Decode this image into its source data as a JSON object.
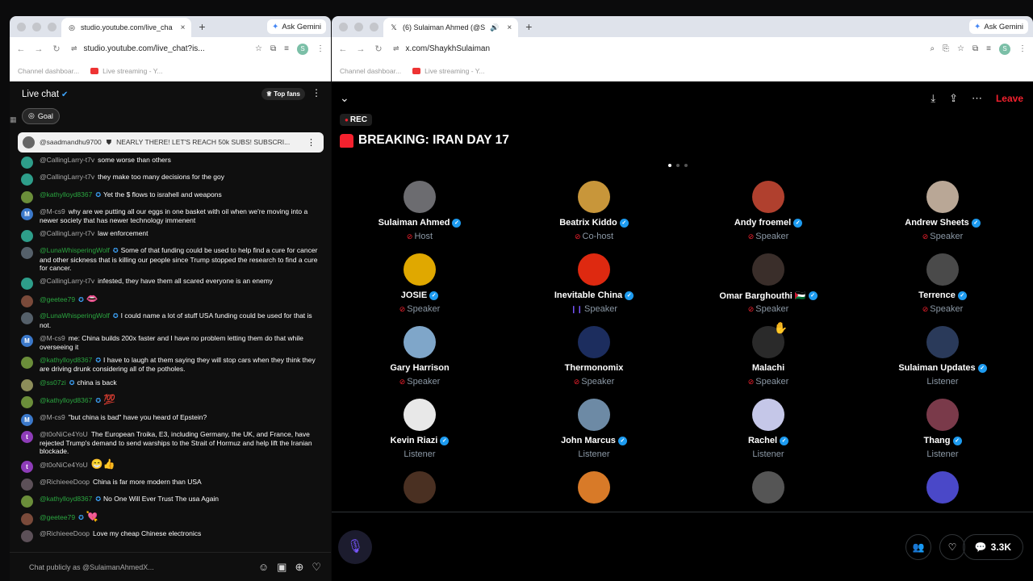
{
  "left_window": {
    "tab": {
      "title": "studio.youtube.com/live_cha",
      "close": "×"
    },
    "new_tab": "+",
    "gemini": "Ask Gemini",
    "url": "studio.youtube.com/live_chat?is...",
    "bookmarks": [
      "Channel dashboar...",
      "Live streaming - Y..."
    ],
    "profile_initial": "S"
  },
  "chat": {
    "title": "Live chat",
    "top_fans": "Top fans",
    "goal": "Goal",
    "pinned": {
      "author": "@saadmandhu9700",
      "text": "NEARLY THERE! LET'S REACH 50k SUBS! SUBSCRI..."
    },
    "messages": [
      {
        "author": "@CallingLarry-t7v",
        "text": "some worse than others",
        "member": false,
        "badge": false,
        "avatar_color": "#2e9e8a",
        "avatar_text": ""
      },
      {
        "author": "@CallingLarry-t7v",
        "text": "they make too many decisions for the goy",
        "member": false,
        "badge": false,
        "avatar_color": "#2e9e8a",
        "avatar_text": ""
      },
      {
        "author": "@kathylloyd8367",
        "text": "Yet the $ flows to israhell and weapons",
        "member": true,
        "badge": true,
        "avatar_color": "#6b8e3a",
        "avatar_text": ""
      },
      {
        "author": "@M-cs9",
        "text": "why are we putting all our eggs in one basket with oil when we're moving into a newer society that has newer technology immenent",
        "member": false,
        "badge": false,
        "avatar_color": "#3b78c9",
        "avatar_text": "M"
      },
      {
        "author": "@CallingLarry-t7v",
        "text": "law enforcement",
        "member": false,
        "badge": false,
        "avatar_color": "#2e9e8a",
        "avatar_text": ""
      },
      {
        "author": "@LunaWhisperingWolf",
        "text": "Some of that funding could be used to help find a cure for cancer and other sickness that is killing our people since Trump stopped the research to find a cure for cancer.",
        "member": true,
        "badge": true,
        "avatar_color": "#55606a",
        "avatar_text": ""
      },
      {
        "author": "@CallingLarry-t7v",
        "text": "infested, they have them all scared everyone is an enemy",
        "member": false,
        "badge": false,
        "avatar_color": "#2e9e8a",
        "avatar_text": ""
      },
      {
        "author": "@geetee79",
        "text": "👄",
        "member": true,
        "badge": true,
        "avatar_color": "#7a4a3a",
        "avatar_text": ""
      },
      {
        "author": "@LunaWhisperingWolf",
        "text": "I could name a lot of stuff USA funding could be used for that is not.",
        "member": true,
        "badge": true,
        "avatar_color": "#55606a",
        "avatar_text": ""
      },
      {
        "author": "@M-cs9",
        "text": "me: China builds 200x faster and I have no problem letting them do that while overseeing it",
        "member": false,
        "badge": false,
        "avatar_color": "#3b78c9",
        "avatar_text": "M"
      },
      {
        "author": "@kathylloyd8367",
        "text": "I have to laugh at them saying they will stop cars when they think they are driving drunk considering all of the potholes.",
        "member": true,
        "badge": true,
        "avatar_color": "#6b8e3a",
        "avatar_text": ""
      },
      {
        "author": "@ss07zi",
        "text": "china is back",
        "member": true,
        "badge": true,
        "avatar_color": "#8d8d5a",
        "avatar_text": ""
      },
      {
        "author": "@kathylloyd8367",
        "text": "💯",
        "member": true,
        "badge": true,
        "avatar_color": "#6b8e3a",
        "avatar_text": ""
      },
      {
        "author": "@M-cs9",
        "text": "\"but china is bad\" have you heard of Epstein?",
        "member": false,
        "badge": false,
        "avatar_color": "#3b78c9",
        "avatar_text": "M"
      },
      {
        "author": "@t0oNiCe4YoU",
        "text": "The European Troika, E3, including Germany, the UK, and France, have rejected Trump's demand to send warships to the Strait of Hormuz and help lift the Iranian blockade.",
        "member": false,
        "badge": false,
        "avatar_color": "#8e3cb8",
        "avatar_text": "t"
      },
      {
        "author": "@t0oNiCe4YoU",
        "text": "😁👍",
        "member": false,
        "badge": false,
        "avatar_color": "#8e3cb8",
        "avatar_text": "t"
      },
      {
        "author": "@RichieeeDoop",
        "text": "China is far more modern than USA",
        "member": false,
        "badge": false,
        "avatar_color": "#5c5058",
        "avatar_text": ""
      },
      {
        "author": "@kathylloyd8367",
        "text": "No One Will Ever Trust The usa Again",
        "member": true,
        "badge": true,
        "avatar_color": "#6b8e3a",
        "avatar_text": ""
      },
      {
        "author": "@geetee79",
        "text": "💘",
        "member": true,
        "badge": true,
        "avatar_color": "#7a4a3a",
        "avatar_text": ""
      },
      {
        "author": "@RichieeeDoop",
        "text": "Love my cheap Chinese electronics",
        "member": false,
        "badge": false,
        "avatar_color": "#5c5058",
        "avatar_text": ""
      }
    ],
    "input_placeholder": "Chat publicly as @SulaimanAhmedX..."
  },
  "right_window": {
    "tab": {
      "title": "(6) Sulaiman Ahmed (@S",
      "close": "×"
    },
    "new_tab": "+",
    "gemini": "Ask Gemini",
    "url": "x.com/ShaykhSulaiman",
    "bookmarks": [
      "Channel dashboar...",
      "Live streaming - Y..."
    ],
    "profile_initial": "S"
  },
  "space": {
    "leave": "Leave",
    "rec": "REC",
    "title": "BREAKING: IRAN DAY 17",
    "people": [
      {
        "name": "Sulaiman Ahmed",
        "role": "Host",
        "verified": true,
        "mic": "muted",
        "color": "#6c6c70"
      },
      {
        "name": "Beatrix Kiddo",
        "role": "Co-host",
        "verified": true,
        "mic": "muted",
        "color": "#c8963a"
      },
      {
        "name": "Andy froemel",
        "role": "Speaker",
        "verified": true,
        "mic": "muted",
        "color": "#b0402e"
      },
      {
        "name": "Andrew Sheets",
        "role": "Speaker",
        "verified": true,
        "mic": "muted",
        "color": "#b9a796"
      },
      {
        "name": "JOSIE",
        "role": "Speaker",
        "verified": true,
        "mic": "muted",
        "color": "#e0a800"
      },
      {
        "name": "Inevitable China",
        "role": "Speaker",
        "verified": true,
        "mic": "speaking",
        "color": "#de2910"
      },
      {
        "name": "Omar Barghouthi 🇵🇸",
        "role": "Speaker",
        "verified": true,
        "mic": "muted",
        "color": "#3a2e2a"
      },
      {
        "name": "Terrence",
        "role": "Speaker",
        "verified": true,
        "mic": "muted",
        "color": "#4a4a4a"
      },
      {
        "name": "Gary Harrison",
        "role": "Speaker",
        "verified": false,
        "mic": "muted",
        "color": "#7fa6c9"
      },
      {
        "name": "Thermonomix",
        "role": "Speaker",
        "verified": false,
        "mic": "muted",
        "color": "#1c2d5e"
      },
      {
        "name": "Malachi",
        "role": "Speaker",
        "verified": false,
        "mic": "muted",
        "color": "#2a2a2a",
        "hand": "✋"
      },
      {
        "name": "Sulaiman Updates",
        "role": "Listener",
        "verified": true,
        "mic": "none",
        "color": "#2a3a5a"
      },
      {
        "name": "Kevin Riazi",
        "role": "Listener",
        "verified": true,
        "mic": "none",
        "color": "#e8e8e8"
      },
      {
        "name": "John Marcus",
        "role": "Listener",
        "verified": true,
        "mic": "none",
        "color": "#6d8aa5"
      },
      {
        "name": "Rachel",
        "role": "Listener",
        "verified": true,
        "mic": "none",
        "color": "#c5c7e8"
      },
      {
        "name": "Thang",
        "role": "Listener",
        "verified": true,
        "mic": "none",
        "color": "#7a3a4a"
      },
      {
        "name": "",
        "role": "",
        "verified": false,
        "mic": "none",
        "color": "#4a3022"
      },
      {
        "name": "",
        "role": "",
        "verified": false,
        "mic": "none",
        "color": "#d87a28"
      },
      {
        "name": "",
        "role": "",
        "verified": false,
        "mic": "none",
        "color": "#555555"
      },
      {
        "name": "",
        "role": "",
        "verified": false,
        "mic": "none",
        "color": "#4a48c8"
      }
    ],
    "comment_count": "3.3K"
  }
}
